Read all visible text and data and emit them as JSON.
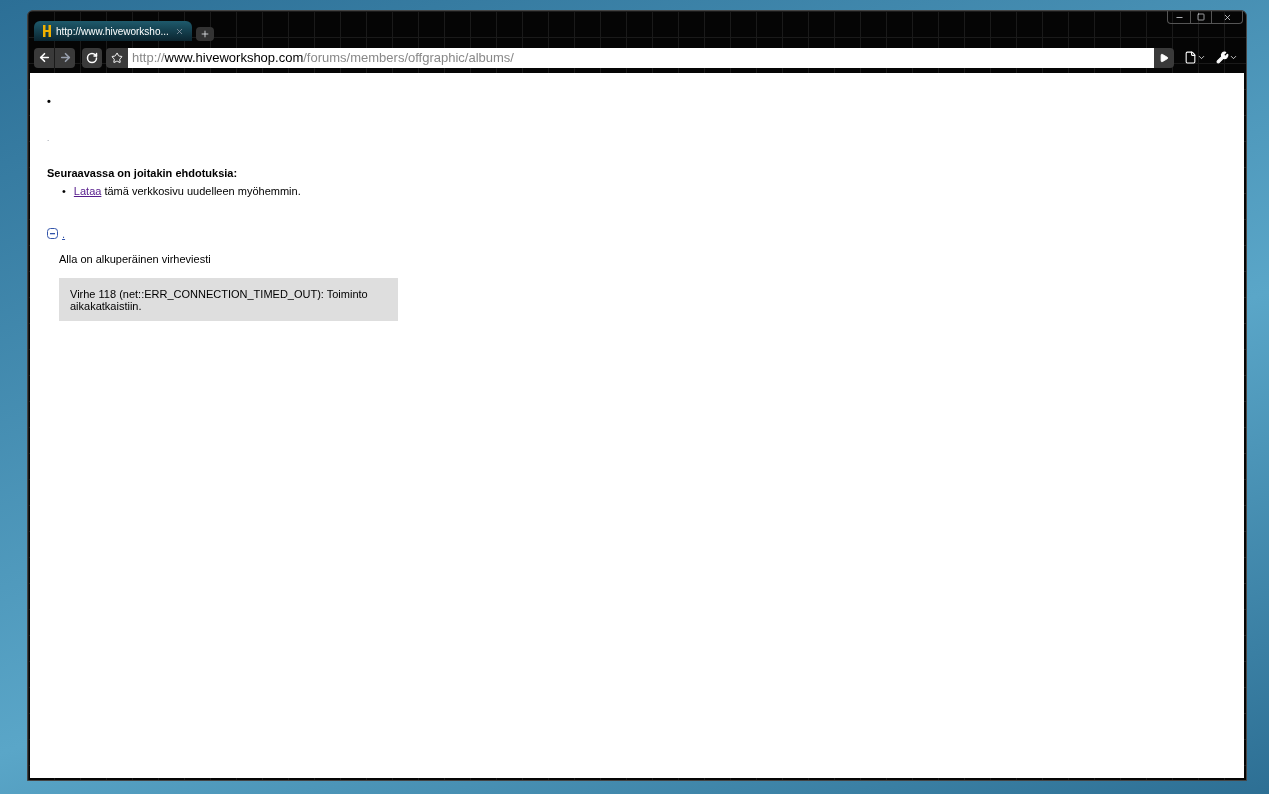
{
  "tab": {
    "title": "http://www.hiveworksho...",
    "selected": true
  },
  "address": {
    "scheme": "http://",
    "host": "www.hiveworkshop.com",
    "path": "/forums/members/offgraphic/albums/"
  },
  "page": {
    "bullet": "•",
    "dot": ".",
    "suggestions_heading": "Seuraavassa on joitakin ehdotuksia:",
    "suggestions": [
      {
        "marker": "•",
        "link": "Lataa",
        "text": " tämä verkkosivu uudelleen myöhemmin."
      }
    ],
    "details": {
      "expanded": true,
      "toggle_text": ".",
      "intro": "Alla on alkuperäinen virheviesti",
      "error": "Virhe 118 (net::ERR_CONNECTION_TIMED_OUT): Toiminto aikakatkaistiin."
    }
  }
}
